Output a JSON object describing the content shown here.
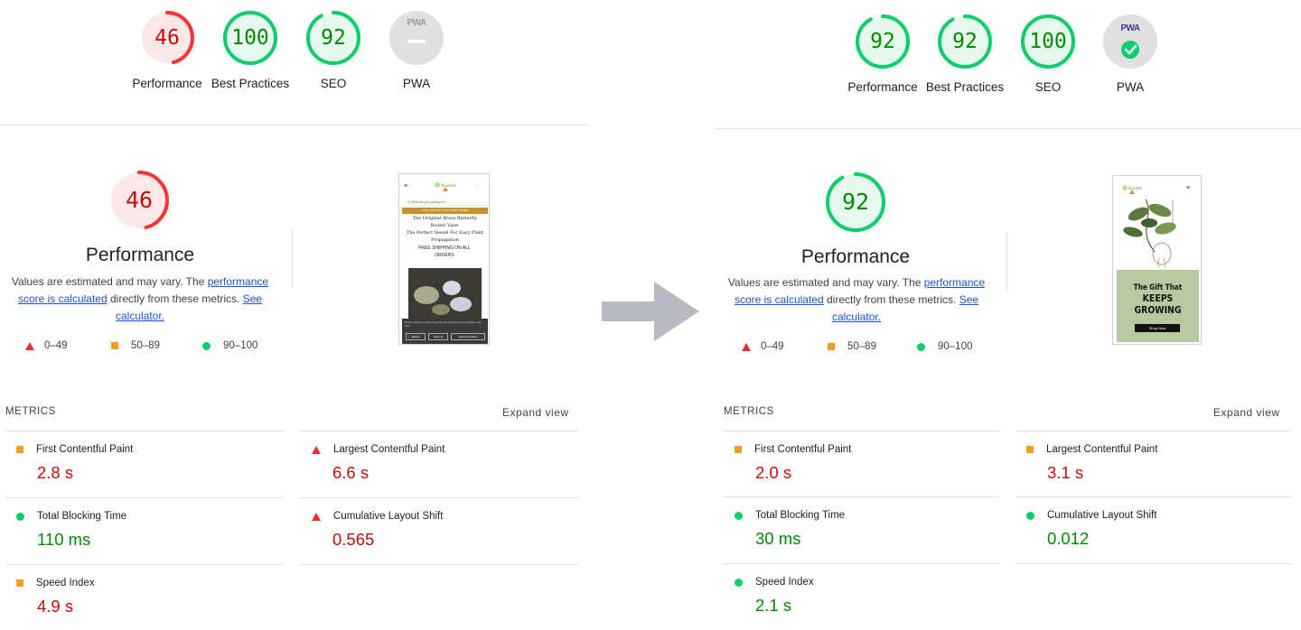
{
  "before": {
    "gauges": [
      {
        "score": "46",
        "label": "Performance",
        "value": 0.46,
        "status": "fail"
      },
      {
        "score": "100",
        "label": "Best Practices",
        "value": 1.0,
        "status": "pass"
      },
      {
        "score": "92",
        "label": "SEO",
        "value": 0.92,
        "status": "pass"
      },
      {
        "score": "",
        "label": "PWA",
        "value": 0,
        "status": "na",
        "badge": "PWA"
      }
    ],
    "performance": {
      "score": "46",
      "value": 0.46,
      "title": "Performance",
      "desc_prefix": "Values are estimated and may vary. The ",
      "desc_link1": "performance score is calculated",
      "desc_middle": " directly from these metrics. ",
      "desc_link2": "See calculator."
    },
    "screenshot": {
      "search": "What are you looking for?",
      "banner": "SAVE 10% OFF YOUR FIRST ORDER",
      "line1": "The Original Brass Butterfly",
      "line2": "Rooter Vase:",
      "line3": "The Perfect Vessel For Easy Plant",
      "line4": "Propagation",
      "shipping": "FREE SHIPPING ON ALL ORDERS",
      "cookie_text": "We use cookies to ensure you get the best experience on our website. Learn more.",
      "btn1": "Settings",
      "btn2": "Reject all",
      "btn3": "Accept All Cookies"
    },
    "metrics": [
      {
        "label": "First Contentful Paint",
        "value": "2.8 s",
        "status": "average"
      },
      {
        "label": "Largest Contentful Paint",
        "value": "6.6 s",
        "status": "fail"
      },
      {
        "label": "Total Blocking Time",
        "value": "110 ms",
        "status": "pass"
      },
      {
        "label": "Cumulative Layout Shift",
        "value": "0.565",
        "status": "fail"
      },
      {
        "label": "Speed Index",
        "value": "4.9 s",
        "status": "average"
      }
    ]
  },
  "after": {
    "gauges": [
      {
        "score": "92",
        "label": "Performance",
        "value": 0.92,
        "status": "pass"
      },
      {
        "score": "92",
        "label": "Best Practices",
        "value": 0.92,
        "status": "pass"
      },
      {
        "score": "100",
        "label": "SEO",
        "value": 1.0,
        "status": "pass"
      },
      {
        "score": "",
        "label": "PWA",
        "value": 0,
        "status": "pwa-pass",
        "badge": "PWA"
      }
    ],
    "performance": {
      "score": "92",
      "value": 0.92,
      "title": "Performance",
      "desc_prefix": "Values are estimated and may vary. The ",
      "desc_link1": "performance score is calculated",
      "desc_middle": " directly from these metrics. ",
      "desc_link2": "See calculator."
    },
    "screenshot": {
      "headline1": "The Gift That",
      "headline2": "KEEPS",
      "headline3": "GROWING",
      "cta": "Shop Now"
    },
    "metrics": [
      {
        "label": "First Contentful Paint",
        "value": "2.0 s",
        "status": "average"
      },
      {
        "label": "Largest Contentful Paint",
        "value": "3.1 s",
        "status": "average"
      },
      {
        "label": "Total Blocking Time",
        "value": "30 ms",
        "status": "pass"
      },
      {
        "label": "Cumulative Layout Shift",
        "value": "0.012",
        "status": "pass"
      },
      {
        "label": "Speed Index",
        "value": "2.1 s",
        "status": "pass"
      }
    ]
  },
  "legend": {
    "fail": "0–49",
    "average": "50–89",
    "pass": "90–100"
  },
  "metrics_heading": "METRICS",
  "expand_view": "Expand view",
  "colors": {
    "fail": "#ff3333",
    "fail_bg": "#fde8e8",
    "pass": "#0cce6b",
    "pass_bg": "#e7f9ef",
    "average": "#f29d1f",
    "na_bg": "#e0e0e0",
    "pwa_ok": "#0cce6b",
    "arrow": "#b9b9c4"
  }
}
